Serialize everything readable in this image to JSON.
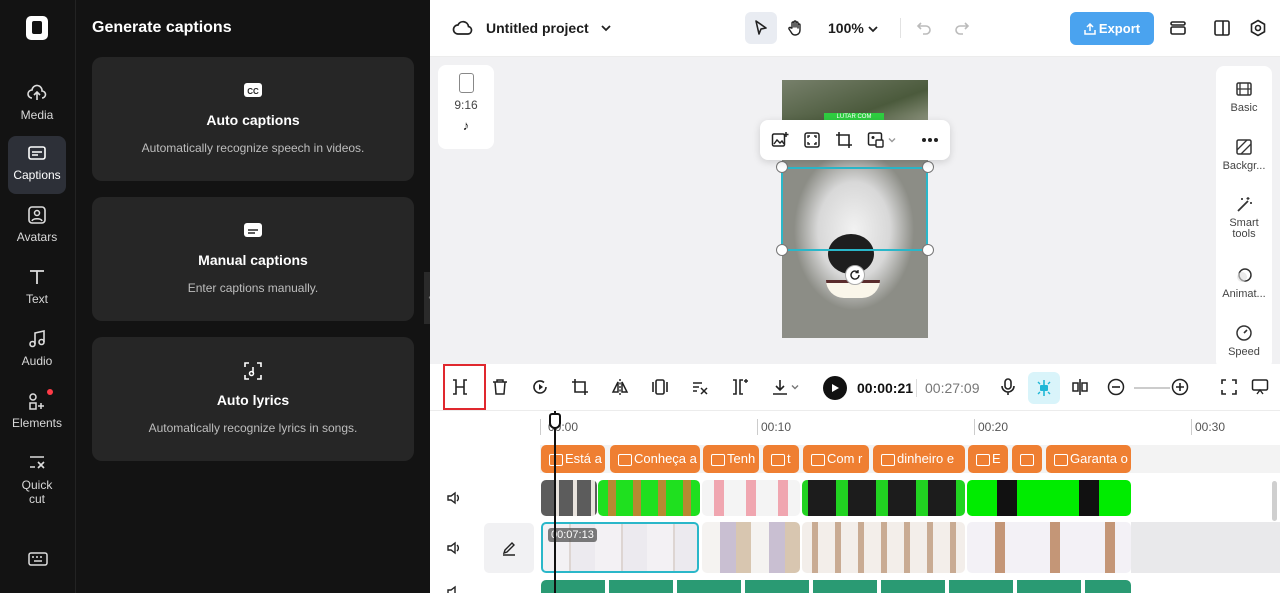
{
  "sidebar": {
    "items": [
      {
        "label": "Media",
        "icon": "cloud-upload-icon"
      },
      {
        "label": "Captions",
        "icon": "captions-icon",
        "active": true
      },
      {
        "label": "Avatars",
        "icon": "avatar-icon"
      },
      {
        "label": "Text",
        "icon": "text-icon"
      },
      {
        "label": "Audio",
        "icon": "music-icon"
      },
      {
        "label": "Elements",
        "icon": "elements-icon",
        "notification": true
      },
      {
        "label": "Quick\ncut",
        "icon": "quick-cut-icon"
      }
    ],
    "keyboard_icon": "keyboard-icon"
  },
  "panel": {
    "title": "Generate captions",
    "cards": [
      {
        "title": "Auto captions",
        "desc": "Automatically recognize speech in videos.",
        "icon": "cc-icon"
      },
      {
        "title": "Manual captions",
        "desc": "Enter captions manually.",
        "icon": "subtitle-icon"
      },
      {
        "title": "Auto lyrics",
        "desc": "Automatically recognize lyrics in songs.",
        "icon": "lyrics-icon"
      }
    ]
  },
  "topbar": {
    "project": "Untitled project",
    "zoom": "100%",
    "export_label": "Export"
  },
  "canvas": {
    "ratio_label": "9:16",
    "video_label": "LUTAR COM",
    "properties": [
      {
        "label": "Basic"
      },
      {
        "label": "Backgr..."
      },
      {
        "label": "Smart\ntools"
      },
      {
        "label": "Animat..."
      },
      {
        "label": "Speed"
      }
    ]
  },
  "timeline_toolbar": {
    "current_time": "00:00:21",
    "total_time": "00:27:09"
  },
  "timeline": {
    "ruler": [
      "00:00",
      "00:10",
      "00:20",
      "00:30"
    ],
    "captions": [
      "Está a",
      "Conheça a",
      "Tenh",
      "t",
      "Com r",
      "dinheiro e",
      "E",
      "",
      "Garanta o"
    ],
    "selected_clip_time": "00:07:13"
  },
  "colors": {
    "accent": "#2ab7c9",
    "export": "#4aa3ef",
    "caption": "#ef7f32",
    "highlight": "#e0282e"
  }
}
